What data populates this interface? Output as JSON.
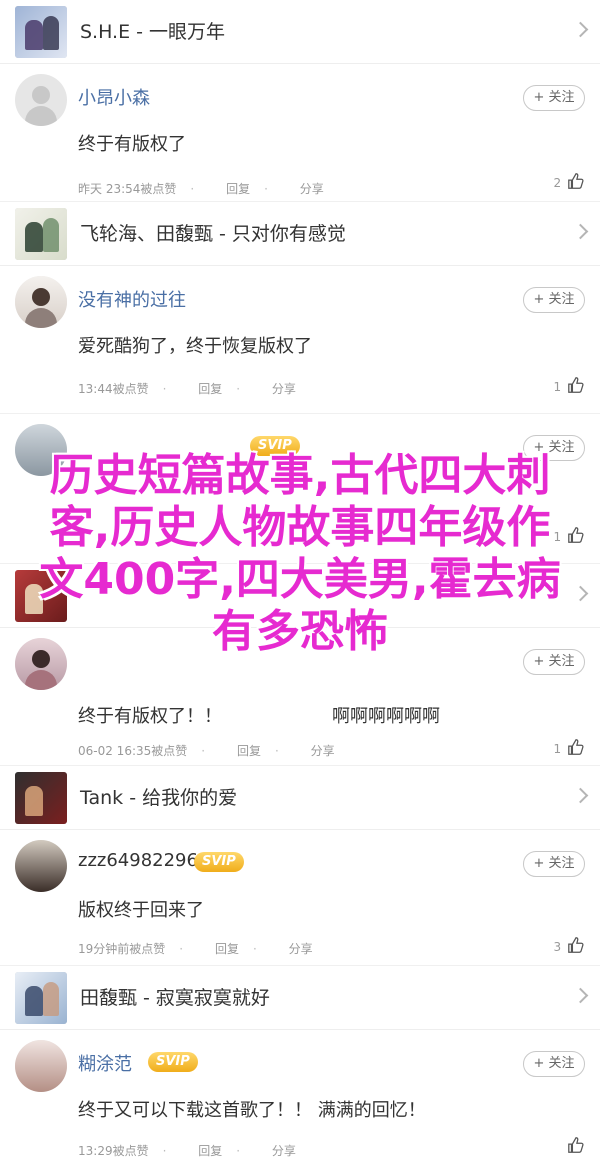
{
  "items": [
    {
      "type": "song",
      "title": "S.H.E - 一眼万年"
    },
    {
      "type": "comment",
      "user": "小昂小森",
      "svip": false,
      "follow": "+ 关注",
      "content": "终于有版权了",
      "time": "昨天 23:54被点赞",
      "reply": "回复",
      "share": "分享",
      "likes": "2"
    },
    {
      "type": "song",
      "title": "飞轮海、田馥甄 - 只对你有感觉"
    },
    {
      "type": "comment",
      "user": "没有神的过往",
      "svip": false,
      "follow": "+ 关注",
      "content": "爱死酷狗了，终于恢复版权了",
      "time": "13:44被点赞",
      "reply": "回复",
      "share": "分享",
      "likes": "1"
    },
    {
      "type": "comment",
      "user": "",
      "svip": true,
      "follow": "+ 关注",
      "content": "",
      "time": "",
      "reply": "",
      "share": "",
      "likes": "1"
    },
    {
      "type": "song",
      "title": ""
    },
    {
      "type": "comment",
      "user": "",
      "svip": false,
      "follow": "+ 关注",
      "content": "终于有版权了！！",
      "content2": "啊啊啊啊啊啊",
      "time": "06-02 16:35被点赞",
      "reply": "回复",
      "share": "分享",
      "likes": "1"
    },
    {
      "type": "song",
      "title": "Tank - 给我你的爱"
    },
    {
      "type": "comment",
      "user": "zzz64982296",
      "svip": true,
      "follow": "+ 关注",
      "content": "版权终于回来了",
      "time": "19分钟前被点赞",
      "reply": "回复",
      "share": "分享",
      "likes": "3"
    },
    {
      "type": "song",
      "title": "田馥甄 - 寂寞寂寞就好"
    },
    {
      "type": "comment",
      "user": "糊涂范",
      "svip": true,
      "follow": "+ 关注",
      "content": "终于又可以下载这首歌了！！ 满满的回忆！",
      "time": "13:29被点赞",
      "reply": "回复",
      "share": "分享",
      "likes": ""
    }
  ],
  "svip_label": "SVIP",
  "overlay": {
    "text": "历史短篇故事,古代四大刺客,历史人物故事四年级作文400字,四大美男,霍去病有多恐怖"
  },
  "colors": {
    "overlay": "#e62ad0",
    "username": "#4a6fa5",
    "svip": "#f0ad1b"
  }
}
